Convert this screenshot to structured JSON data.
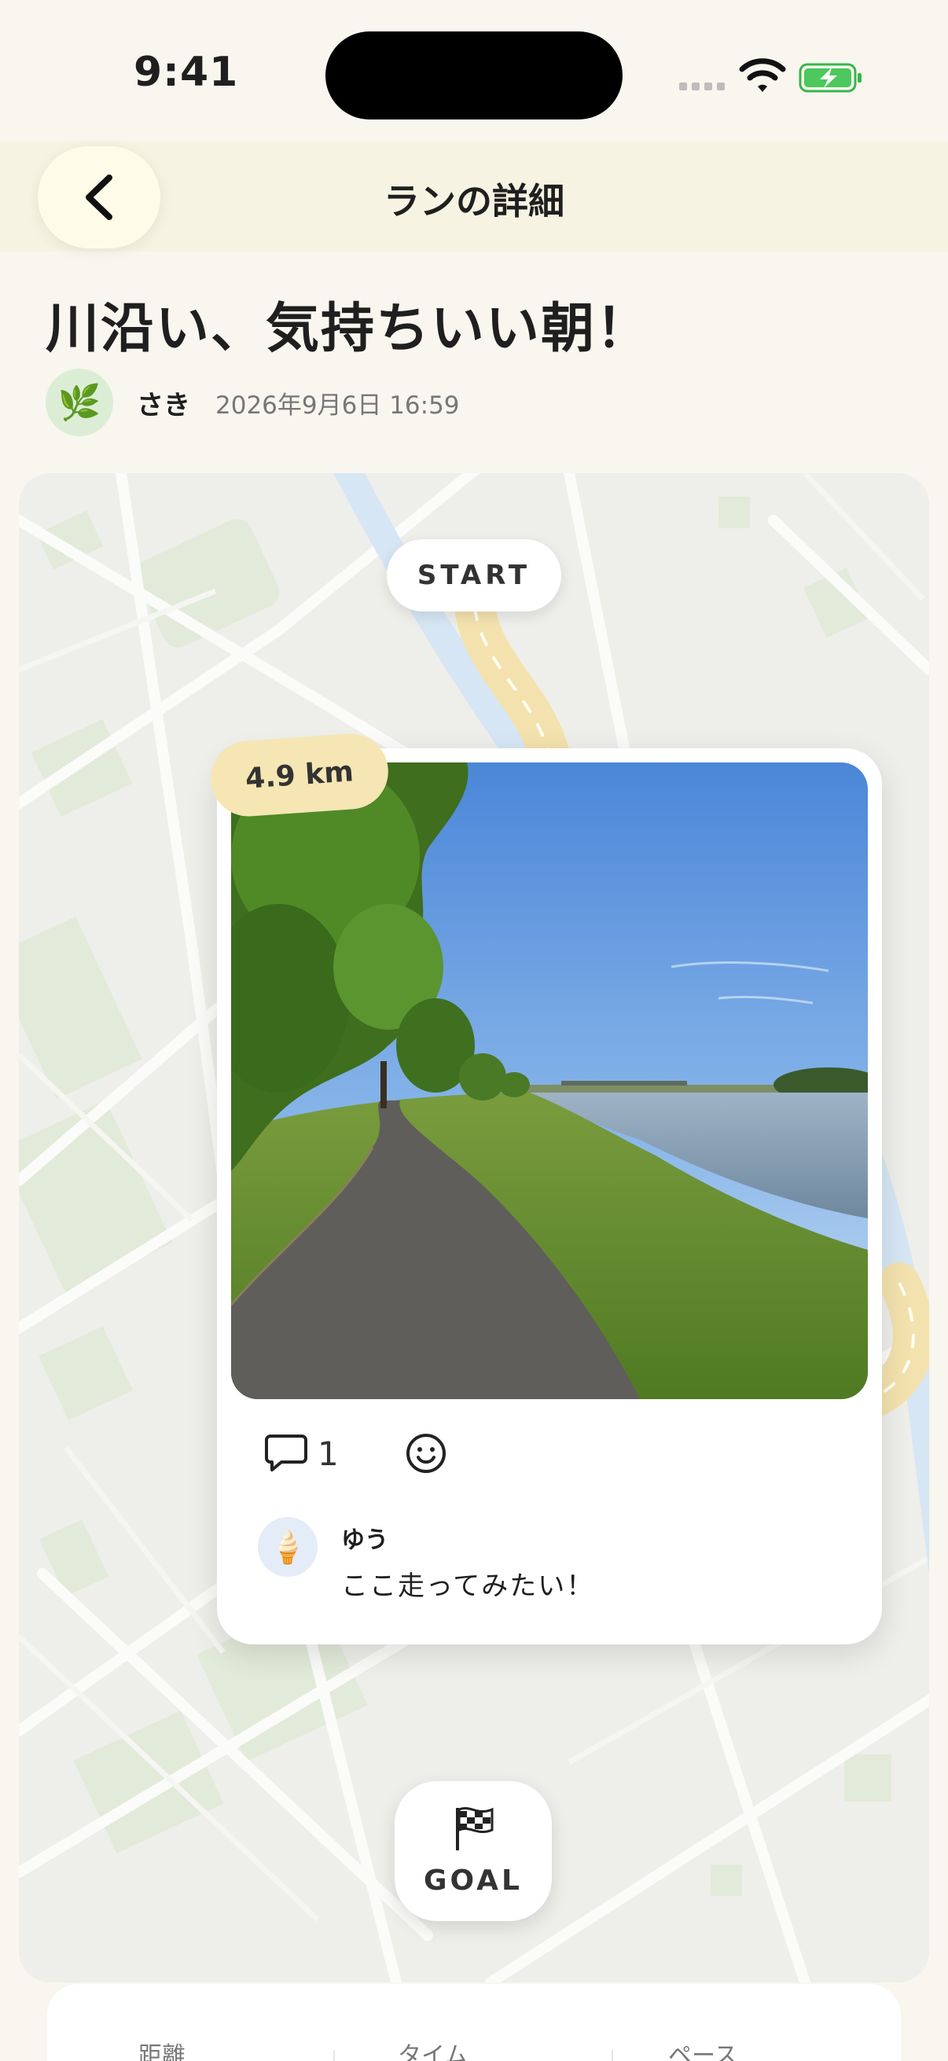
{
  "status_bar": {
    "time": "9:41"
  },
  "nav": {
    "title": "ランの詳細"
  },
  "post": {
    "title": "川沿い、気持ちいい朝！",
    "author": "さき",
    "author_avatar": "🌿",
    "date": "2026年9月6日 16:59"
  },
  "map": {
    "start_label": "START",
    "goal_label": "GOAL"
  },
  "card": {
    "distance": "4.9 km",
    "comment_count": "1",
    "comments": [
      {
        "avatar": "🍦",
        "name": "ゆう",
        "text": "ここ走ってみたい！"
      }
    ]
  },
  "stats": {
    "labels": [
      "距離",
      "タイム",
      "ペース"
    ]
  },
  "colors": {
    "background": "#f8f6ee",
    "route": "#f3e2ad",
    "badge": "#f5e6b4",
    "river": "#d6e6f4"
  }
}
